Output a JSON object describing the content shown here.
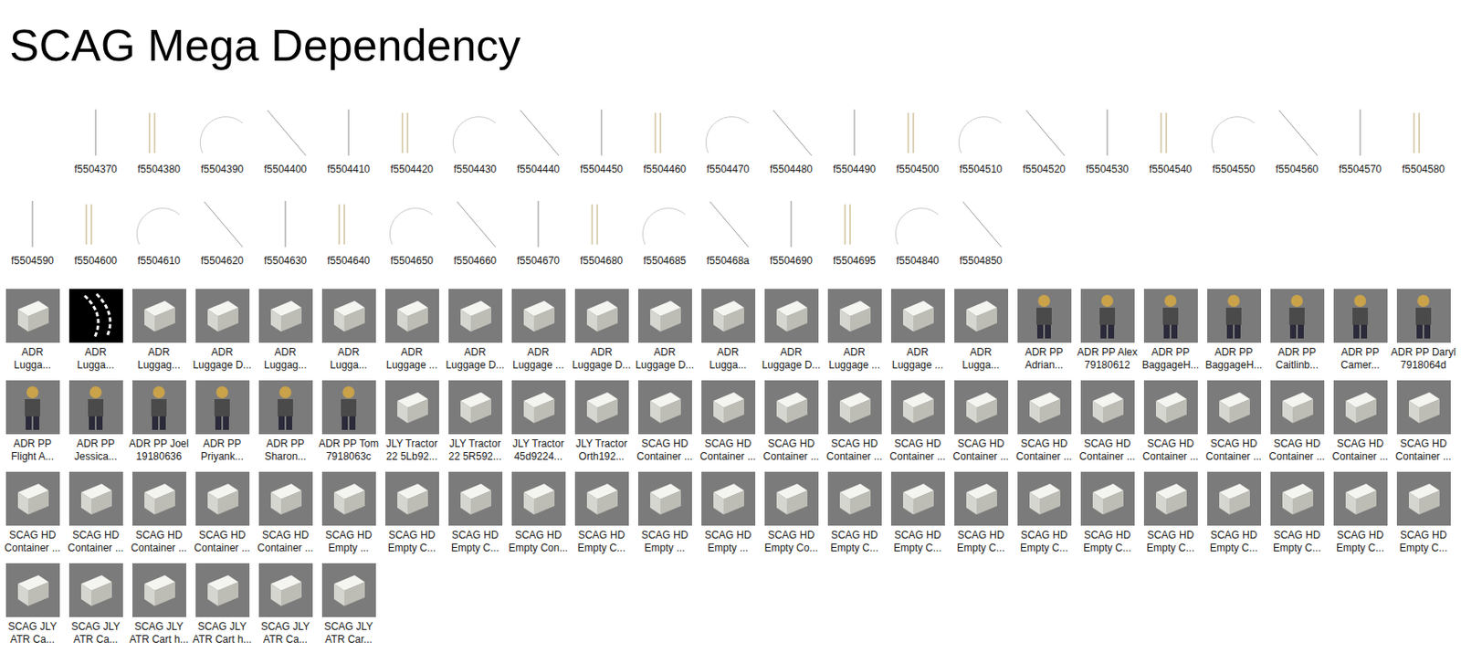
{
  "window": {
    "title": "SCAG Mega Dependency"
  },
  "rows": [
    {
      "items": [
        {
          "label": [],
          "kind": "blank"
        },
        {
          "label": [
            "f5504370"
          ],
          "kind": "drawing"
        },
        {
          "label": [
            "f5504380"
          ],
          "kind": "drawing"
        },
        {
          "label": [
            "f5504390"
          ],
          "kind": "drawing"
        },
        {
          "label": [
            "f5504400"
          ],
          "kind": "drawing"
        },
        {
          "label": [
            "f5504410"
          ],
          "kind": "drawing"
        },
        {
          "label": [
            "f5504420"
          ],
          "kind": "drawing"
        },
        {
          "label": [
            "f5504430"
          ],
          "kind": "drawing"
        },
        {
          "label": [
            "f5504440"
          ],
          "kind": "drawing"
        },
        {
          "label": [
            "f5504450"
          ],
          "kind": "drawing"
        },
        {
          "label": [
            "f5504460"
          ],
          "kind": "drawing"
        },
        {
          "label": [
            "f5504470"
          ],
          "kind": "drawing"
        },
        {
          "label": [
            "f5504480"
          ],
          "kind": "drawing"
        },
        {
          "label": [
            "f5504490"
          ],
          "kind": "drawing"
        },
        {
          "label": [
            "f5504500"
          ],
          "kind": "drawing"
        },
        {
          "label": [
            "f5504510"
          ],
          "kind": "drawing"
        },
        {
          "label": [
            "f5504520"
          ],
          "kind": "drawing"
        },
        {
          "label": [
            "f5504530"
          ],
          "kind": "drawing"
        },
        {
          "label": [
            "f5504540"
          ],
          "kind": "drawing"
        },
        {
          "label": [
            "f5504550"
          ],
          "kind": "drawing"
        },
        {
          "label": [
            "f5504560"
          ],
          "kind": "drawing"
        },
        {
          "label": [
            "f5504570"
          ],
          "kind": "drawing"
        },
        {
          "label": [
            "f5504580"
          ],
          "kind": "drawing"
        }
      ]
    },
    {
      "items": [
        {
          "label": [
            "f5504590"
          ],
          "kind": "drawing"
        },
        {
          "label": [
            "f5504600"
          ],
          "kind": "drawing"
        },
        {
          "label": [
            "f5504610"
          ],
          "kind": "drawing"
        },
        {
          "label": [
            "f5504620"
          ],
          "kind": "drawing"
        },
        {
          "label": [
            "f5504630"
          ],
          "kind": "drawing"
        },
        {
          "label": [
            "f5504640"
          ],
          "kind": "drawing"
        },
        {
          "label": [
            "f5504650"
          ],
          "kind": "drawing"
        },
        {
          "label": [
            "f5504660"
          ],
          "kind": "drawing"
        },
        {
          "label": [
            "f5504670"
          ],
          "kind": "drawing"
        },
        {
          "label": [
            "f5504680"
          ],
          "kind": "drawing"
        },
        {
          "label": [
            "f5504685"
          ],
          "kind": "drawing"
        },
        {
          "label": [
            "f550468a"
          ],
          "kind": "drawing"
        },
        {
          "label": [
            "f5504690"
          ],
          "kind": "drawing"
        },
        {
          "label": [
            "f5504695"
          ],
          "kind": "drawing"
        },
        {
          "label": [
            "f5504840"
          ],
          "kind": "drawing"
        },
        {
          "label": [
            "f5504850"
          ],
          "kind": "drawing"
        }
      ]
    },
    {
      "items": [
        {
          "label": [
            "ADR",
            "Lugga..."
          ],
          "kind": "object"
        },
        {
          "label": [
            "ADR",
            "Lugga..."
          ],
          "kind": "dark"
        },
        {
          "label": [
            "ADR",
            "Luggag..."
          ],
          "kind": "object"
        },
        {
          "label": [
            "ADR",
            "Luggage D..."
          ],
          "kind": "object"
        },
        {
          "label": [
            "ADR",
            "Luggag..."
          ],
          "kind": "object"
        },
        {
          "label": [
            "ADR",
            "Lugga..."
          ],
          "kind": "object"
        },
        {
          "label": [
            "ADR",
            "Luggage ..."
          ],
          "kind": "object"
        },
        {
          "label": [
            "ADR",
            "Luggage D..."
          ],
          "kind": "object"
        },
        {
          "label": [
            "ADR",
            "Luggage ..."
          ],
          "kind": "object"
        },
        {
          "label": [
            "ADR",
            "Luggage D..."
          ],
          "kind": "object"
        },
        {
          "label": [
            "ADR",
            "Luggage D..."
          ],
          "kind": "object"
        },
        {
          "label": [
            "ADR",
            "Lugga..."
          ],
          "kind": "object"
        },
        {
          "label": [
            "ADR",
            "Luggage D..."
          ],
          "kind": "object"
        },
        {
          "label": [
            "ADR",
            "Luggage ..."
          ],
          "kind": "object"
        },
        {
          "label": [
            "ADR",
            "Luggage ..."
          ],
          "kind": "object"
        },
        {
          "label": [
            "ADR",
            "Lugga..."
          ],
          "kind": "object"
        },
        {
          "label": [
            "ADR PP",
            "Adrian..."
          ],
          "kind": "person"
        },
        {
          "label": [
            "ADR PP Alex",
            "79180612"
          ],
          "kind": "person"
        },
        {
          "label": [
            "ADR PP",
            "BaggageH..."
          ],
          "kind": "person"
        },
        {
          "label": [
            "ADR PP",
            "BaggageH..."
          ],
          "kind": "person"
        },
        {
          "label": [
            "ADR PP",
            "Caitlinb..."
          ],
          "kind": "person"
        },
        {
          "label": [
            "ADR PP",
            "Camer..."
          ],
          "kind": "person"
        },
        {
          "label": [
            "ADR PP Daryl",
            "7918064d"
          ],
          "kind": "person"
        }
      ]
    },
    {
      "items": [
        {
          "label": [
            "ADR PP",
            "Flight A..."
          ],
          "kind": "person"
        },
        {
          "label": [
            "ADR PP",
            "Jessica..."
          ],
          "kind": "person"
        },
        {
          "label": [
            "ADR PP Joel",
            "19180636"
          ],
          "kind": "person"
        },
        {
          "label": [
            "ADR PP",
            "Priyank..."
          ],
          "kind": "person"
        },
        {
          "label": [
            "ADR PP",
            "Sharon..."
          ],
          "kind": "person"
        },
        {
          "label": [
            "ADR PP Tom",
            "7918063c"
          ],
          "kind": "person"
        },
        {
          "label": [
            "JLY Tractor",
            "22 5Lb92..."
          ],
          "kind": "object"
        },
        {
          "label": [
            "JLY Tractor",
            "22 5R592..."
          ],
          "kind": "object"
        },
        {
          "label": [
            "JLY Tractor",
            "45d9224..."
          ],
          "kind": "object"
        },
        {
          "label": [
            "JLY Tractor",
            "Orth192..."
          ],
          "kind": "object"
        },
        {
          "label": [
            "SCAG HD",
            "Container ..."
          ],
          "kind": "object"
        },
        {
          "label": [
            "SCAG HD",
            "Container ..."
          ],
          "kind": "object"
        },
        {
          "label": [
            "SCAG HD",
            "Container ..."
          ],
          "kind": "object"
        },
        {
          "label": [
            "SCAG HD",
            "Container ..."
          ],
          "kind": "object"
        },
        {
          "label": [
            "SCAG HD",
            "Container ..."
          ],
          "kind": "object"
        },
        {
          "label": [
            "SCAG HD",
            "Container ..."
          ],
          "kind": "object"
        },
        {
          "label": [
            "SCAG HD",
            "Container ..."
          ],
          "kind": "object"
        },
        {
          "label": [
            "SCAG HD",
            "Container ..."
          ],
          "kind": "object"
        },
        {
          "label": [
            "SCAG HD",
            "Container ..."
          ],
          "kind": "object"
        },
        {
          "label": [
            "SCAG HD",
            "Container ..."
          ],
          "kind": "object"
        },
        {
          "label": [
            "SCAG HD",
            "Container ..."
          ],
          "kind": "object"
        },
        {
          "label": [
            "SCAG HD",
            "Container ..."
          ],
          "kind": "object"
        },
        {
          "label": [
            "SCAG HD",
            "Container ..."
          ],
          "kind": "object"
        }
      ]
    },
    {
      "items": [
        {
          "label": [
            "SCAG HD",
            "Container ..."
          ],
          "kind": "object"
        },
        {
          "label": [
            "SCAG HD",
            "Container ..."
          ],
          "kind": "object"
        },
        {
          "label": [
            "SCAG HD",
            "Container ..."
          ],
          "kind": "object"
        },
        {
          "label": [
            "SCAG HD",
            "Container ..."
          ],
          "kind": "object"
        },
        {
          "label": [
            "SCAG HD",
            "Container ..."
          ],
          "kind": "object"
        },
        {
          "label": [
            "SCAG HD",
            "Empty ..."
          ],
          "kind": "object"
        },
        {
          "label": [
            "SCAG HD",
            "Empty C..."
          ],
          "kind": "object"
        },
        {
          "label": [
            "SCAG HD",
            "Empty C..."
          ],
          "kind": "object"
        },
        {
          "label": [
            "SCAG HD",
            "Empty Con..."
          ],
          "kind": "object"
        },
        {
          "label": [
            "SCAG HD",
            "Empty C..."
          ],
          "kind": "object"
        },
        {
          "label": [
            "SCAG HD",
            "Empty ..."
          ],
          "kind": "object"
        },
        {
          "label": [
            "SCAG HD",
            "Empty ..."
          ],
          "kind": "object"
        },
        {
          "label": [
            "SCAG HD",
            "Empty Co..."
          ],
          "kind": "object"
        },
        {
          "label": [
            "SCAG HD",
            "Empty C..."
          ],
          "kind": "object"
        },
        {
          "label": [
            "SCAG HD",
            "Empty C..."
          ],
          "kind": "object"
        },
        {
          "label": [
            "SCAG HD",
            "Empty C..."
          ],
          "kind": "object"
        },
        {
          "label": [
            "SCAG HD",
            "Empty C..."
          ],
          "kind": "object"
        },
        {
          "label": [
            "SCAG HD",
            "Empty C..."
          ],
          "kind": "object"
        },
        {
          "label": [
            "SCAG HD",
            "Empty C..."
          ],
          "kind": "object"
        },
        {
          "label": [
            "SCAG HD",
            "Empty C..."
          ],
          "kind": "object"
        },
        {
          "label": [
            "SCAG HD",
            "Empty C..."
          ],
          "kind": "object"
        },
        {
          "label": [
            "SCAG HD",
            "Empty C..."
          ],
          "kind": "object"
        },
        {
          "label": [
            "SCAG HD",
            "Empty C..."
          ],
          "kind": "object"
        }
      ]
    },
    {
      "items": [
        {
          "label": [
            "SCAG JLY",
            "ATR Ca..."
          ],
          "kind": "object"
        },
        {
          "label": [
            "SCAG JLY",
            "ATR Ca..."
          ],
          "kind": "object"
        },
        {
          "label": [
            "SCAG JLY",
            "ATR Cart h..."
          ],
          "kind": "object"
        },
        {
          "label": [
            "SCAG JLY",
            "ATR Cart h..."
          ],
          "kind": "object"
        },
        {
          "label": [
            "SCAG JLY",
            "ATR Ca..."
          ],
          "kind": "object"
        },
        {
          "label": [
            "SCAG JLY",
            "ATR Car..."
          ],
          "kind": "object"
        }
      ]
    }
  ]
}
